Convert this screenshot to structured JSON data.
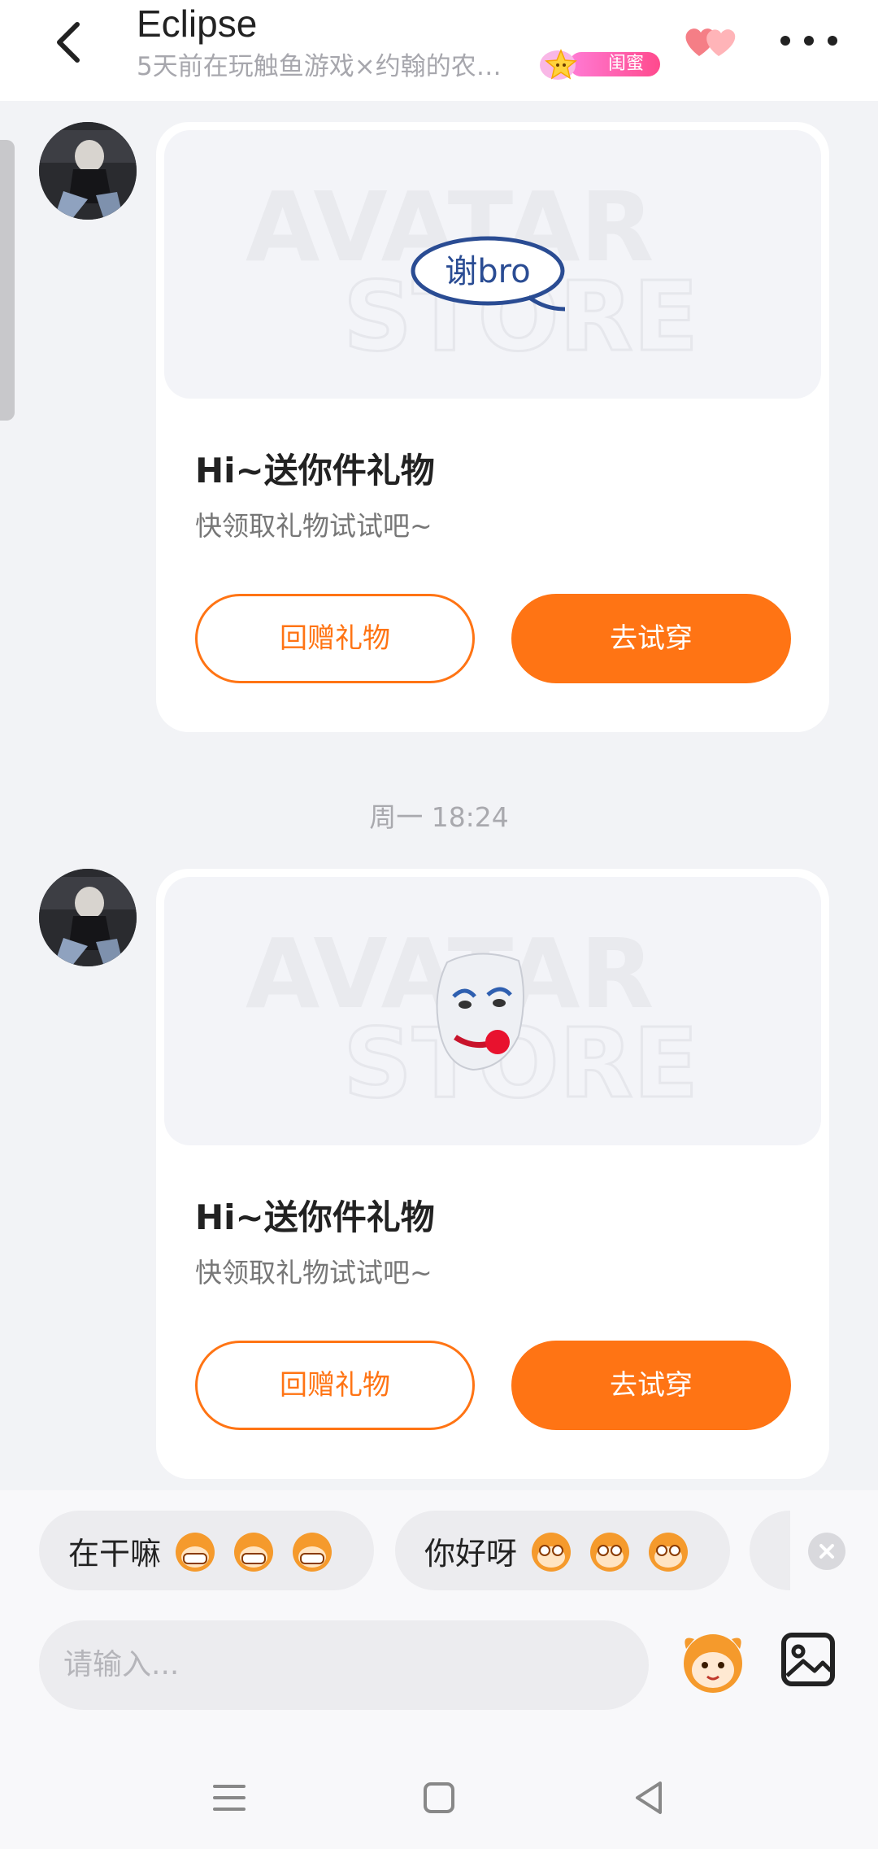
{
  "header": {
    "title": "Eclipse",
    "subtitle": "5天前在玩触鱼游戏×约翰的农…",
    "badge_label": "闺蜜"
  },
  "messages": [
    {
      "gift_text": "谢bro",
      "watermark": [
        "AVATAR",
        "STORE"
      ],
      "title": "Hi~送你件礼物",
      "desc": "快领取礼物试试吧~",
      "return_gift_label": "回赠礼物",
      "try_on_label": "去试穿"
    },
    {
      "gift_text": "",
      "watermark": [
        "AVATAR",
        "STORE"
      ],
      "title": "Hi~送你件礼物",
      "desc": "快领取礼物试试吧~",
      "return_gift_label": "回赠礼物",
      "try_on_label": "去试穿"
    }
  ],
  "timestamp": "周一 18:24",
  "quick_replies": [
    {
      "text": "在干嘛",
      "emoji": "grinning-monkey-emoji"
    },
    {
      "text": "你好呀",
      "emoji": "surprised-monkey-emoji"
    }
  ],
  "input": {
    "placeholder": "请输入..."
  },
  "colors": {
    "accent": "#ff7414",
    "background": "#f2f3f6",
    "badge": "#ff4a8d"
  },
  "icons": [
    "back-arrow-icon",
    "hearts-icon",
    "more-icon",
    "close-icon",
    "emoji-icon",
    "image-icon",
    "menu-icon",
    "home-icon",
    "back-triangle-icon"
  ]
}
